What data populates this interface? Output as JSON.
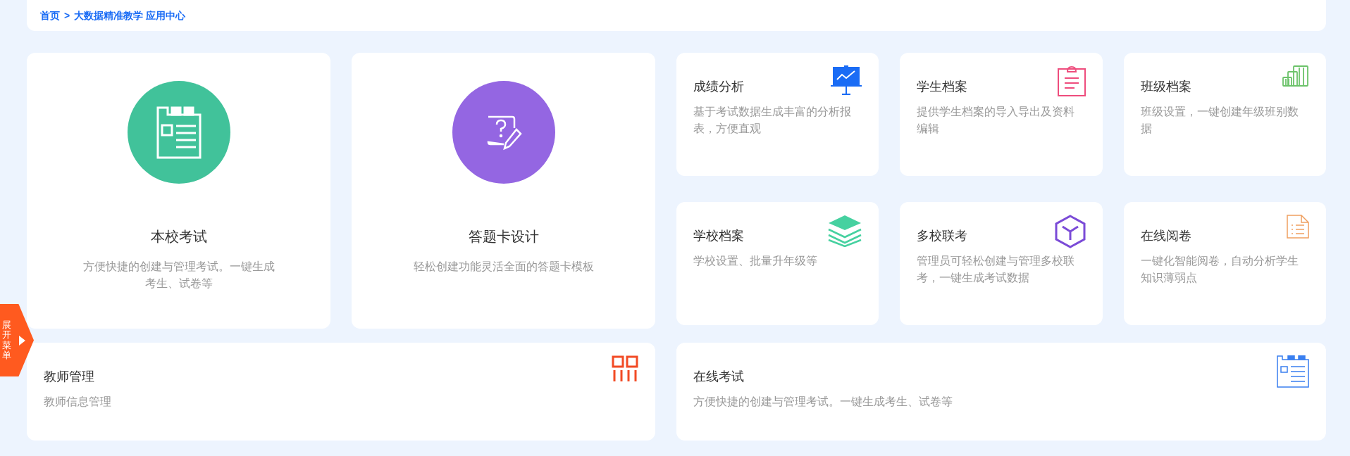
{
  "breadcrumb": {
    "home": "首页",
    "separator": ">",
    "current": "大数据精准教学 应用中心"
  },
  "feature_cards": [
    {
      "title": "本校考试",
      "description": "方便快捷的创建与管理考试。一键生成考生、试卷等",
      "color": "#41c29a"
    },
    {
      "title": "答题卡设计",
      "description": "轻松创建功能灵活全面的答题卡模板",
      "color": "#9466e2"
    }
  ],
  "app_cards": [
    {
      "title": "成绩分析",
      "description": "基于考试数据生成丰富的分析报表，方便直观"
    },
    {
      "title": "学生档案",
      "description": "提供学生档案的导入导出及资料编辑"
    },
    {
      "title": "班级档案",
      "description": "班级设置，一键创建年级班别数据"
    },
    {
      "title": "学校档案",
      "description": "学校设置、批量升年级等"
    },
    {
      "title": "多校联考",
      "description": "管理员可轻松创建与管理多校联考，一键生成考试数据"
    },
    {
      "title": "在线阅卷",
      "description": "一键化智能阅卷，自动分析学生知识薄弱点"
    }
  ],
  "wide_cards": [
    {
      "title": "教师管理",
      "description": "教师信息管理"
    },
    {
      "title": "在线考试",
      "description": "方便快捷的创建与管理考试。一键生成考生、试卷等"
    }
  ],
  "side_tab": {
    "label": "展开菜单"
  }
}
